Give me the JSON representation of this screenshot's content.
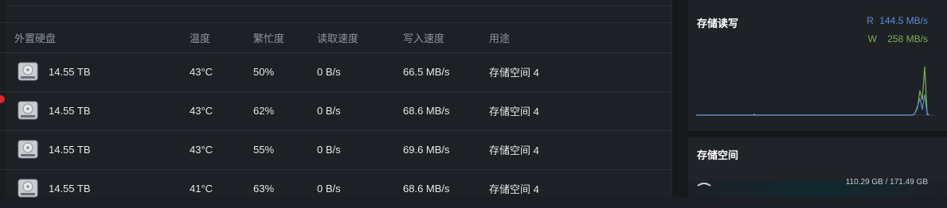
{
  "table": {
    "headers": {
      "disk": "外置硬盘",
      "temp": "温度",
      "busy": "繁忙度",
      "read": "读取速度",
      "write": "写入速度",
      "usage": "用途"
    },
    "rows": [
      {
        "capacity": "14.55 TB",
        "temp": "43°C",
        "busy": "50%",
        "read": "0 B/s",
        "write": "66.5 MB/s",
        "usage": "存储空间 4"
      },
      {
        "capacity": "14.55 TB",
        "temp": "43°C",
        "busy": "62%",
        "read": "0 B/s",
        "write": "68.6 MB/s",
        "usage": "存储空间 4"
      },
      {
        "capacity": "14.55 TB",
        "temp": "43°C",
        "busy": "55%",
        "read": "0 B/s",
        "write": "69.6 MB/s",
        "usage": "存储空间 4"
      },
      {
        "capacity": "14.55 TB",
        "temp": "41°C",
        "busy": "63%",
        "read": "0 B/s",
        "write": "68.6 MB/s",
        "usage": "存储空间 4"
      }
    ]
  },
  "storage_rw": {
    "title": "存储读写",
    "read_prefix": "R",
    "read_value": "144.5 MB/s",
    "write_prefix": "W",
    "write_value": "258 MB/s",
    "colors": {
      "read": "#5b8ddb",
      "write": "#7ab24a"
    }
  },
  "storage_space": {
    "title": "存储空间",
    "usage_text": "110.29 GB / 171.49 GB"
  }
}
